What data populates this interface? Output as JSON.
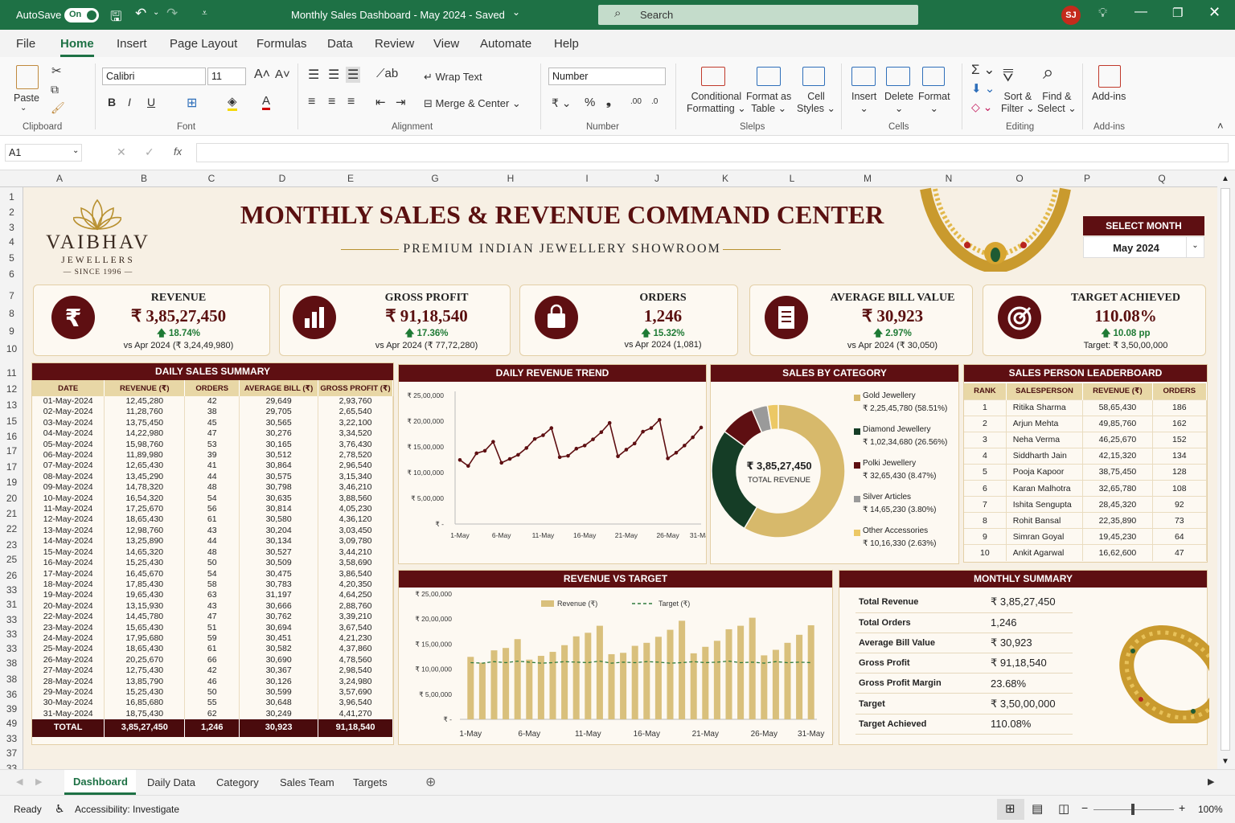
{
  "titlebar": {
    "autosave": "AutoSave",
    "autosave_state": "On",
    "doc_title": "Monthly Sales Dashboard - May 2024  -  Saved",
    "search_placeholder": "Search",
    "user_initials": "SJ"
  },
  "menu": [
    "File",
    "Home",
    "Insert",
    "Page Layout",
    "Formulas",
    "Data",
    "Review",
    "View",
    "Automate",
    "Help"
  ],
  "ribbon": {
    "paste": "Paste",
    "font_name": "Calibri",
    "font_size": "11",
    "wrap_text": "Wrap Text",
    "merge_center": "Merge & Center",
    "number_format": "Number",
    "conditional_1": "Conditional",
    "conditional_2": "Formatting",
    "format_table_1": "Format as",
    "format_table_2": "Table",
    "cell_styles_1": "Cell",
    "cell_styles_2": "Styles",
    "insert": "Insert",
    "delete": "Delete",
    "format": "Format",
    "sort_1": "Sort &",
    "sort_2": "Filter",
    "find_1": "Find &",
    "find_2": "Select",
    "addins": "Add-ins",
    "groups": {
      "clipboard": "Clipboard",
      "font": "Font",
      "alignment": "Alignment",
      "number": "Number",
      "styles": "Slelps",
      "cells": "Cells",
      "editing": "Editing",
      "addins": "Add-ins"
    }
  },
  "formula_bar": {
    "name_box": "A1",
    "fx": "fx",
    "value": ""
  },
  "columns": [
    "A",
    "B",
    "C",
    "D",
    "E",
    "G",
    "H",
    "I",
    "J",
    "K",
    "L",
    "M",
    "N",
    "O",
    "P",
    "Q"
  ],
  "rows": [
    "1",
    "2",
    "3",
    "4",
    "5",
    "6",
    "7",
    "8",
    "9",
    "10",
    "11",
    "12",
    "13",
    "15",
    "16",
    "17",
    "17",
    "19",
    "20",
    "21",
    "22",
    "23",
    "25",
    "26",
    "33",
    "31",
    "33",
    "33",
    "33",
    "38",
    "38",
    "36",
    "39",
    "49",
    "33",
    "37",
    "33",
    "38"
  ],
  "dashboard": {
    "logo_name": "VAIBHAV",
    "logo_sub": "JEWELLERS",
    "logo_since": "— SINCE 1996 —",
    "title": "MONTHLY SALES & REVENUE COMMAND CENTER",
    "subtitle": "PREMIUM INDIAN JEWELLERY SHOWROOM",
    "select_month_label": "SELECT MONTH",
    "selected_month": "May 2024"
  },
  "kpis": [
    {
      "title": "REVENUE",
      "value": "₹ 3,85,27,450",
      "change": "🡅 18.74%",
      "compare": "vs Apr 2024 (₹ 3,24,49,980)",
      "icon": "rupee-icon"
    },
    {
      "title": "GROSS PROFIT",
      "value": "₹ 91,18,540",
      "change": "🡅 17.36%",
      "compare": "vs Apr 2024 (₹ 77,72,280)",
      "icon": "bar-chart-icon"
    },
    {
      "title": "ORDERS",
      "value": "1,246",
      "change": "🡅 15.32%",
      "compare": "vs Apr 2024 (1,081)",
      "icon": "shopping-bag-icon"
    },
    {
      "title": "AVERAGE BILL VALUE",
      "value": "₹ 30,923",
      "change": "🡅 2.97%",
      "compare": "vs Apr 2024 (₹ 30,050)",
      "icon": "receipt-icon"
    },
    {
      "title": "TARGET ACHIEVED",
      "value": "110.08%",
      "change": "🡅 10.08 pp",
      "compare": "Target: ₹ 3,50,00,000",
      "icon": "target-icon"
    }
  ],
  "daily_summary": {
    "title": "DAILY SALES SUMMARY",
    "headers": [
      "DATE",
      "REVENUE (₹)",
      "ORDERS",
      "AVERAGE BILL (₹)",
      "GROSS PROFIT (₹)"
    ],
    "rows": [
      [
        "01-May-2024",
        "12,45,280",
        "42",
        "29,649",
        "2,93,760"
      ],
      [
        "02-May-2024",
        "11,28,760",
        "38",
        "29,705",
        "2,65,540"
      ],
      [
        "03-May-2024",
        "13,75,450",
        "45",
        "30,565",
        "3,22,100"
      ],
      [
        "04-May-2024",
        "14,22,980",
        "47",
        "30,276",
        "3,34,520"
      ],
      [
        "05-May-2024",
        "15,98,760",
        "53",
        "30,165",
        "3,76,430"
      ],
      [
        "06-May-2024",
        "11,89,980",
        "39",
        "30,512",
        "2,78,520"
      ],
      [
        "07-May-2024",
        "12,65,430",
        "41",
        "30,864",
        "2,96,540"
      ],
      [
        "08-May-2024",
        "13,45,290",
        "44",
        "30,575",
        "3,15,340"
      ],
      [
        "09-May-2024",
        "14,78,320",
        "48",
        "30,798",
        "3,46,210"
      ],
      [
        "10-May-2024",
        "16,54,320",
        "54",
        "30,635",
        "3,88,560"
      ],
      [
        "11-May-2024",
        "17,25,670",
        "56",
        "30,814",
        "4,05,230"
      ],
      [
        "12-May-2024",
        "18,65,430",
        "61",
        "30,580",
        "4,36,120"
      ],
      [
        "13-May-2024",
        "12,98,760",
        "43",
        "30,204",
        "3,03,450"
      ],
      [
        "14-May-2024",
        "13,25,890",
        "44",
        "30,134",
        "3,09,780"
      ],
      [
        "15-May-2024",
        "14,65,320",
        "48",
        "30,527",
        "3,44,210"
      ],
      [
        "16-May-2024",
        "15,25,430",
        "50",
        "30,509",
        "3,58,690"
      ],
      [
        "17-May-2024",
        "16,45,670",
        "54",
        "30,475",
        "3,86,540"
      ],
      [
        "18-May-2024",
        "17,85,430",
        "58",
        "30,783",
        "4,20,350"
      ],
      [
        "19-May-2024",
        "19,65,430",
        "63",
        "31,197",
        "4,64,250"
      ],
      [
        "20-May-2024",
        "13,15,930",
        "43",
        "30,666",
        "2,88,760"
      ],
      [
        "22-May-2024",
        "14,45,780",
        "47",
        "30,762",
        "3,39,210"
      ],
      [
        "23-May-2024",
        "15,65,430",
        "51",
        "30,694",
        "3,67,540"
      ],
      [
        "24-May-2024",
        "17,95,680",
        "59",
        "30,451",
        "4,21,230"
      ],
      [
        "25-May-2024",
        "18,65,430",
        "61",
        "30,582",
        "4,37,860"
      ],
      [
        "26-May-2024",
        "20,25,670",
        "66",
        "30,690",
        "4,78,560"
      ],
      [
        "27-May-2024",
        "12,75,430",
        "42",
        "30,367",
        "2,98,540"
      ],
      [
        "28-May-2024",
        "13,85,790",
        "46",
        "30,126",
        "3,24,980"
      ],
      [
        "29-May-2024",
        "15,25,430",
        "50",
        "30,599",
        "3,57,690"
      ],
      [
        "30-May-2024",
        "16,85,680",
        "55",
        "30,648",
        "3,96,540"
      ],
      [
        "31-May-2024",
        "18,75,430",
        "62",
        "30,249",
        "4,41,270"
      ]
    ],
    "total": [
      "TOTAL",
      "3,85,27,450",
      "1,246",
      "30,923",
      "91,18,540"
    ]
  },
  "trend": {
    "title": "DAILY REVENUE TREND",
    "yticks": [
      "₹ 25,00,000",
      "₹ 20,00,000",
      "₹ 15,00,000",
      "₹ 10,00,000",
      "₹ 5,00,000",
      "₹ -"
    ],
    "xticks": [
      "1-May",
      "6-May",
      "11-May",
      "16-May",
      "21-May",
      "26-May",
      "31-May"
    ]
  },
  "category": {
    "title": "SALES BY CATEGORY",
    "center_value": "₹ 3,85,27,450",
    "center_label": "TOTAL REVENUE",
    "items": [
      {
        "name": "Gold Jewellery",
        "detail": "₹ 2,25,45,780 (58.51%)",
        "color": "#d7b96b"
      },
      {
        "name": "Diamond Jewellery",
        "detail": "₹ 1,02,34,680 (26.56%)",
        "color": "#153d26"
      },
      {
        "name": "Polki Jewellery",
        "detail": "₹ 32,65,430 (8.47%)",
        "color": "#5e0f12"
      },
      {
        "name": "Silver Articles",
        "detail": "₹ 14,65,230 (3.80%)",
        "color": "#9a9a9a"
      },
      {
        "name": "Other Accessories",
        "detail": "₹ 10,16,330 (2.63%)",
        "color": "#ecc865"
      }
    ]
  },
  "leaderboard": {
    "title": "SALES PERSON LEADERBOARD",
    "headers": [
      "RANK",
      "SALESPERSON",
      "REVENUE (₹)",
      "ORDERS"
    ],
    "rows": [
      [
        "1",
        "Ritika Sharma",
        "58,65,430",
        "186"
      ],
      [
        "2",
        "Arjun Mehta",
        "49,85,760",
        "162"
      ],
      [
        "3",
        "Neha Verma",
        "46,25,670",
        "152"
      ],
      [
        "4",
        "Siddharth Jain",
        "42,15,320",
        "134"
      ],
      [
        "5",
        "Pooja Kapoor",
        "38,75,450",
        "128"
      ],
      [
        "6",
        "Karan Malhotra",
        "32,65,780",
        "108"
      ],
      [
        "7",
        "Ishita Sengupta",
        "28,45,320",
        "92"
      ],
      [
        "8",
        "Rohit Bansal",
        "22,35,890",
        "73"
      ],
      [
        "9",
        "Simran Goyal",
        "19,45,230",
        "64"
      ],
      [
        "10",
        "Ankit Agarwal",
        "16,62,600",
        "47"
      ]
    ]
  },
  "rvt": {
    "title": "REVENUE VS TARGET",
    "legend_revenue": "Revenue (₹)",
    "legend_target": "Target (₹)",
    "yticks": [
      "₹ 25,00,000",
      "₹ 20,00,000",
      "₹ 15,00,000",
      "₹ 10,00,000",
      "₹ 5,00,000",
      "₹ -"
    ],
    "xticks": [
      "1-May",
      "6-May",
      "11-May",
      "16-May",
      "21-May",
      "26-May",
      "31-May"
    ]
  },
  "monthly_summary": {
    "title": "MONTHLY SUMMARY",
    "rows": [
      [
        "Total Revenue",
        "₹ 3,85,27,450"
      ],
      [
        "Total Orders",
        "1,246"
      ],
      [
        "Average Bill Value",
        "₹ 30,923"
      ],
      [
        "Gross Profit",
        "₹ 91,18,540"
      ],
      [
        "Gross Profit Margin",
        "23.68%"
      ],
      [
        "Target",
        "₹ 3,50,00,000"
      ],
      [
        "Target Achieved",
        "110.08%"
      ]
    ]
  },
  "sheet_tabs": [
    "Dashboard",
    "Daily Data",
    "Category",
    "Sales Team",
    "Targets"
  ],
  "status": {
    "ready": "Ready",
    "accessibility": "Accessibility: Investigate",
    "zoom": "100%"
  },
  "chart_data": [
    {
      "type": "line",
      "title": "DAILY REVENUE TREND",
      "x": [
        "1-May",
        "2-May",
        "3-May",
        "4-May",
        "5-May",
        "6-May",
        "7-May",
        "8-May",
        "9-May",
        "10-May",
        "11-May",
        "12-May",
        "13-May",
        "14-May",
        "15-May",
        "16-May",
        "17-May",
        "18-May",
        "19-May",
        "20-May",
        "22-May",
        "23-May",
        "24-May",
        "25-May",
        "26-May",
        "27-May",
        "28-May",
        "29-May",
        "30-May",
        "31-May"
      ],
      "series": [
        {
          "values": [
            1245280,
            1128760,
            1375450,
            1422980,
            1598760,
            1189980,
            1265430,
            1345290,
            1478320,
            1654320,
            1725670,
            1865430,
            1298760,
            1325890,
            1465320,
            1525430,
            1645670,
            1785430,
            1965430,
            1315930,
            1445780,
            1565430,
            1795680,
            1865430,
            2025670,
            1275430,
            1385790,
            1525430,
            1685680,
            1875430
          ]
        }
      ],
      "ylim": [
        0,
        2500000
      ]
    },
    {
      "type": "pie",
      "title": "SALES BY CATEGORY",
      "categories": [
        "Gold Jewellery",
        "Diamond Jewellery",
        "Polki Jewellery",
        "Silver Articles",
        "Other Accessories"
      ],
      "values": [
        22545780,
        10234680,
        3265430,
        1465230,
        1016330
      ]
    },
    {
      "type": "bar",
      "title": "REVENUE VS TARGET",
      "x": [
        "1-May",
        "2-May",
        "3-May",
        "4-May",
        "5-May",
        "6-May",
        "7-May",
        "8-May",
        "9-May",
        "10-May",
        "11-May",
        "12-May",
        "13-May",
        "14-May",
        "15-May",
        "16-May",
        "17-May",
        "18-May",
        "19-May",
        "20-May",
        "22-May",
        "23-May",
        "24-May",
        "25-May",
        "26-May",
        "27-May",
        "28-May",
        "29-May",
        "30-May",
        "31-May"
      ],
      "series": [
        {
          "name": "Revenue (₹)",
          "values": [
            1245280,
            1128760,
            1375450,
            1422980,
            1598760,
            1189980,
            1265430,
            1345290,
            1478320,
            1654320,
            1725670,
            1865430,
            1298760,
            1325890,
            1465320,
            1525430,
            1645670,
            1785430,
            1965430,
            1315930,
            1445780,
            1565430,
            1795680,
            1865430,
            2025670,
            1275430,
            1385790,
            1525430,
            1685680,
            1875430
          ]
        },
        {
          "name": "Target (₹)",
          "values": [
            1130000,
            1120000,
            1150000,
            1130000,
            1160000,
            1140000,
            1120000,
            1130000,
            1150000,
            1140000,
            1130000,
            1160000,
            1120000,
            1140000,
            1130000,
            1150000,
            1140000,
            1120000,
            1130000,
            1150000,
            1130000,
            1140000,
            1160000,
            1130000,
            1140000,
            1120000,
            1150000,
            1130000,
            1140000,
            1130000
          ]
        }
      ],
      "ylim": [
        0,
        2500000
      ]
    }
  ]
}
